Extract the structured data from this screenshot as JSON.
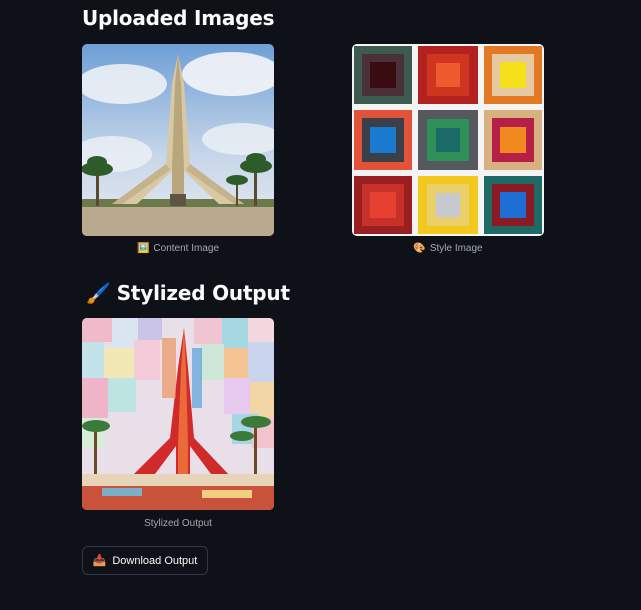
{
  "sections": {
    "uploaded_title": "Uploaded Images",
    "output_title": "Stylized Output",
    "output_icon": "paintbrush-icon"
  },
  "images": {
    "content": {
      "caption": "Content Image",
      "icon": "framed-picture-icon"
    },
    "style": {
      "caption": "Style Image",
      "icon": "palette-icon"
    },
    "output": {
      "caption": "Stylized Output"
    }
  },
  "actions": {
    "download_label": "Download Output",
    "download_icon": "download-tray-icon"
  },
  "colors": {
    "background": "#0e1117",
    "text": "#fafafa",
    "caption": "#a3a8b4",
    "button_border": "#343846"
  }
}
